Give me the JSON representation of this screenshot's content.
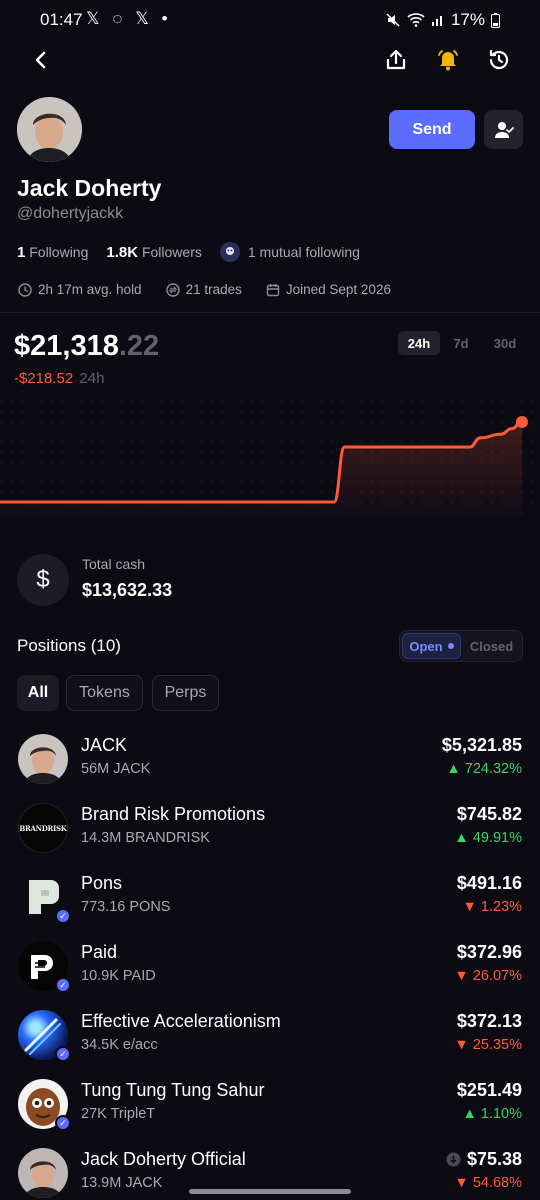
{
  "status": {
    "time": "01:47",
    "notif_icons": "𝕏 ◌ 𝕏 •",
    "battery": "17%"
  },
  "profile": {
    "name": "Jack Doherty",
    "handle": "@dohertyjackk",
    "following_count": "1",
    "following_label": "Following",
    "followers_count": "1.8K",
    "followers_label": "Followers",
    "mutual": "1 mutual following",
    "avg_hold": "2h 17m avg. hold",
    "trades": "21 trades",
    "joined": "Joined Sept 2026",
    "send_label": "Send"
  },
  "balance": {
    "whole": "$21,318",
    "cents": ".22",
    "change": "-$218.52",
    "period": "24h"
  },
  "timeframes": [
    "24h",
    "7d",
    "30d"
  ],
  "chart_data": {
    "type": "line",
    "color": "#ff5a3a",
    "x": [
      0,
      0.64,
      0.66,
      0.68,
      0.9,
      0.92,
      0.96,
      0.98,
      1.0
    ],
    "values": [
      21100,
      21100,
      21250,
      21250,
      21250,
      21275,
      21285,
      21300,
      21318.22
    ]
  },
  "cash": {
    "label": "Total cash",
    "value": "$13,632.33"
  },
  "positions_header": {
    "title": "Positions (10)",
    "open": "Open",
    "closed": "Closed"
  },
  "filters": [
    "All",
    "Tokens",
    "Perps"
  ],
  "positions": [
    {
      "name": "JACK",
      "amount": "56M JACK",
      "value": "$5,321.85",
      "change": "724.32%",
      "dir": "up"
    },
    {
      "name": "Brand Risk Promotions",
      "amount": "14.3M BRANDRISK",
      "value": "$745.82",
      "change": "49.91%",
      "dir": "up"
    },
    {
      "name": "Pons",
      "amount": "773.16 PONS",
      "value": "$491.16",
      "change": "1.23%",
      "dir": "down"
    },
    {
      "name": "Paid",
      "amount": "10.9K PAID",
      "value": "$372.96",
      "change": "26.07%",
      "dir": "down"
    },
    {
      "name": "Effective Accelerationism",
      "amount": "34.5K e/acc",
      "value": "$372.13",
      "change": "25.35%",
      "dir": "down"
    },
    {
      "name": "Tung Tung Tung Sahur",
      "amount": "27K TripleT",
      "value": "$251.49",
      "change": "1.10%",
      "dir": "up"
    },
    {
      "name": "Jack Doherty Official",
      "amount": "13.9M JACK",
      "value": "$75.38",
      "change": "54.68%",
      "dir": "down"
    }
  ],
  "brand_logo_text": "BRANDRISK"
}
